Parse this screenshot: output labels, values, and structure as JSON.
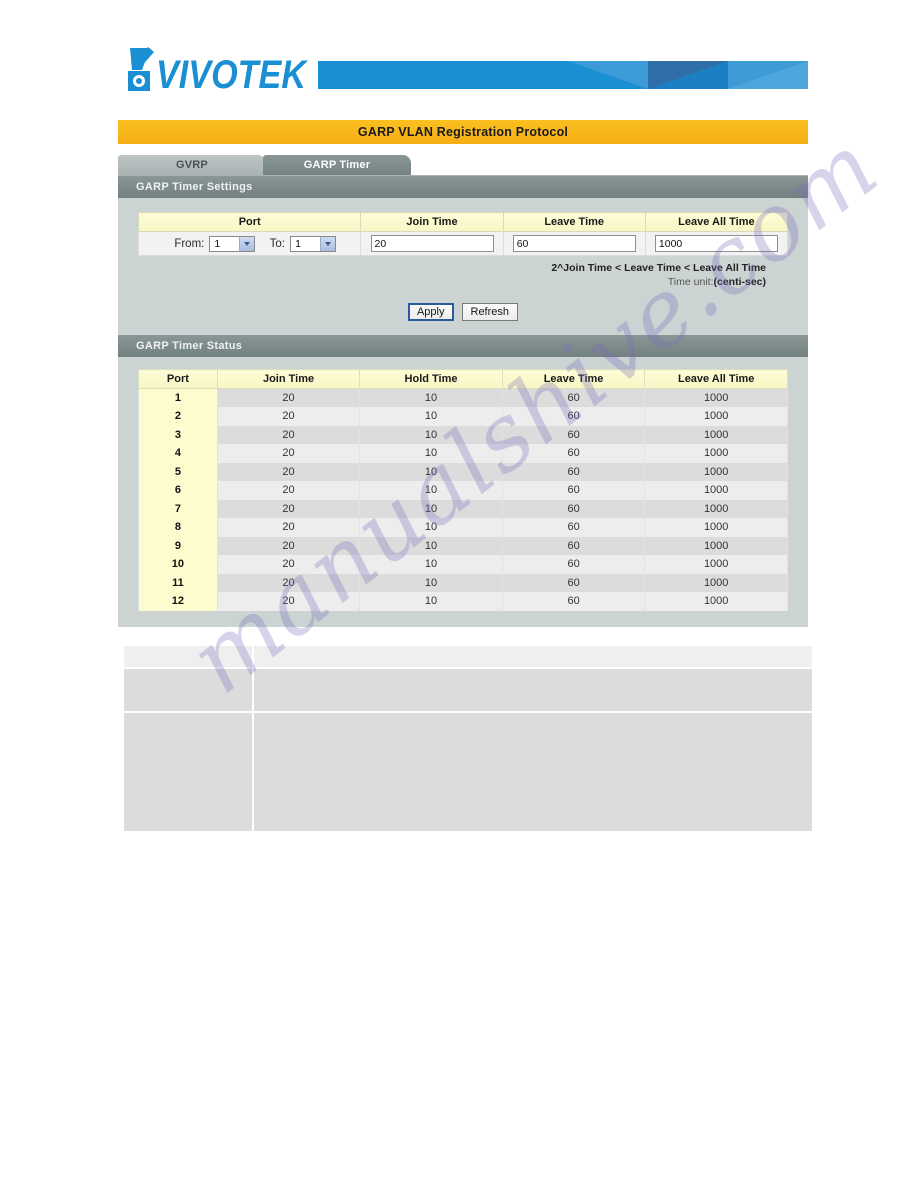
{
  "brand": {
    "logo_text": "VIVOTEK",
    "logo_icon": "vivotek-camera-check-logo"
  },
  "page": {
    "title": "GARP VLAN Registration Protocol",
    "watermark": "manualshive.com"
  },
  "tabs": [
    {
      "label": "GVRP",
      "active": false
    },
    {
      "label": "GARP Timer",
      "active": true
    }
  ],
  "settings_section": {
    "heading": "GARP Timer Settings",
    "headers": [
      "Port",
      "Join Time",
      "Leave Time",
      "Leave All Time"
    ],
    "port_from_label": "From:",
    "port_from_value": "1",
    "port_to_label": "To:",
    "port_to_value": "1",
    "join_time_value": "20",
    "leave_time_value": "60",
    "leave_all_time_value": "1000",
    "hint_line1": "2^Join Time < Leave Time < Leave All Time",
    "hint_line2_prefix": "Time unit:",
    "hint_line2_bold": "(centi-sec)",
    "apply_label": "Apply",
    "refresh_label": "Refresh"
  },
  "status_section": {
    "heading": "GARP Timer Status",
    "headers": [
      "Port",
      "Join Time",
      "Hold Time",
      "Leave Time",
      "Leave All Time"
    ],
    "rows": [
      {
        "port": "1",
        "join": "20",
        "hold": "10",
        "leave": "60",
        "leave_all": "1000"
      },
      {
        "port": "2",
        "join": "20",
        "hold": "10",
        "leave": "60",
        "leave_all": "1000"
      },
      {
        "port": "3",
        "join": "20",
        "hold": "10",
        "leave": "60",
        "leave_all": "1000"
      },
      {
        "port": "4",
        "join": "20",
        "hold": "10",
        "leave": "60",
        "leave_all": "1000"
      },
      {
        "port": "5",
        "join": "20",
        "hold": "10",
        "leave": "60",
        "leave_all": "1000"
      },
      {
        "port": "6",
        "join": "20",
        "hold": "10",
        "leave": "60",
        "leave_all": "1000"
      },
      {
        "port": "7",
        "join": "20",
        "hold": "10",
        "leave": "60",
        "leave_all": "1000"
      },
      {
        "port": "8",
        "join": "20",
        "hold": "10",
        "leave": "60",
        "leave_all": "1000"
      },
      {
        "port": "9",
        "join": "20",
        "hold": "10",
        "leave": "60",
        "leave_all": "1000"
      },
      {
        "port": "10",
        "join": "20",
        "hold": "10",
        "leave": "60",
        "leave_all": "1000"
      },
      {
        "port": "11",
        "join": "20",
        "hold": "10",
        "leave": "60",
        "leave_all": "1000"
      },
      {
        "port": "12",
        "join": "20",
        "hold": "10",
        "leave": "60",
        "leave_all": "1000"
      }
    ]
  },
  "bottom_table": {
    "rows": [
      {
        "left": "",
        "right": ""
      },
      {
        "left": "",
        "right": ""
      },
      {
        "left": "",
        "right": ""
      }
    ]
  },
  "colors": {
    "title_bar": "#f7b71d",
    "tab_active": "#7d8a8a",
    "tab_inactive": "#b4bdbd",
    "panel_bg": "#ccd3d3",
    "table_header": "#fcfbcf",
    "brand_blue": "#1b8fd4"
  }
}
